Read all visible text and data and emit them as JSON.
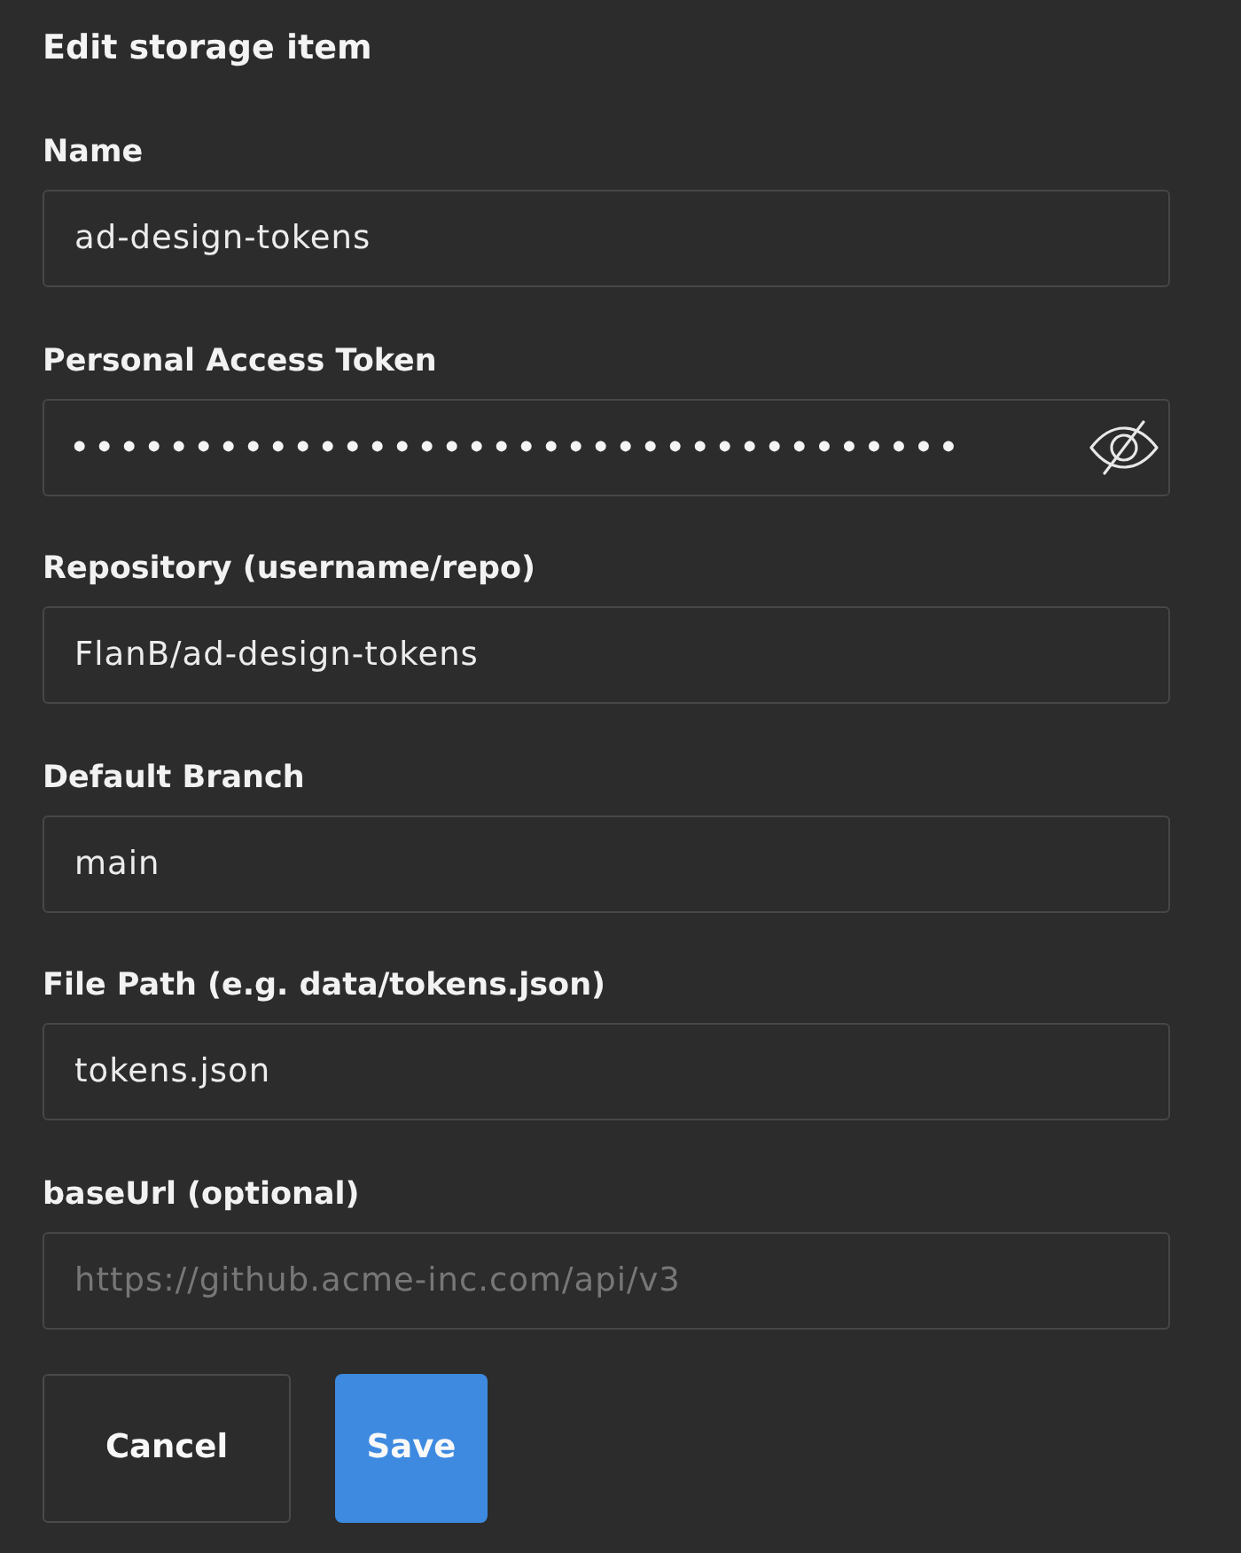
{
  "title": "Edit storage item",
  "fields": [
    {
      "kind": "text",
      "label": "Name",
      "value": "ad-design-tokens"
    },
    {
      "kind": "secret",
      "label": "Personal Access Token",
      "value": "••••••••••••••••••••••••••••••••••••"
    },
    {
      "kind": "text",
      "label": "Repository (username/repo)",
      "value": "FlanB/ad-design-tokens"
    },
    {
      "kind": "text",
      "label": "Default Branch",
      "value": "main"
    },
    {
      "kind": "text",
      "label": "File Path (e.g. data/tokens.json)",
      "value": "tokens.json"
    },
    {
      "kind": "text",
      "label": "baseUrl (optional)",
      "placeholder": "https://github.acme-inc.com/api/v3"
    }
  ],
  "buttons": [
    {
      "kind": "secondary",
      "label": "Cancel"
    },
    {
      "kind": "primary",
      "label": "Save"
    }
  ]
}
